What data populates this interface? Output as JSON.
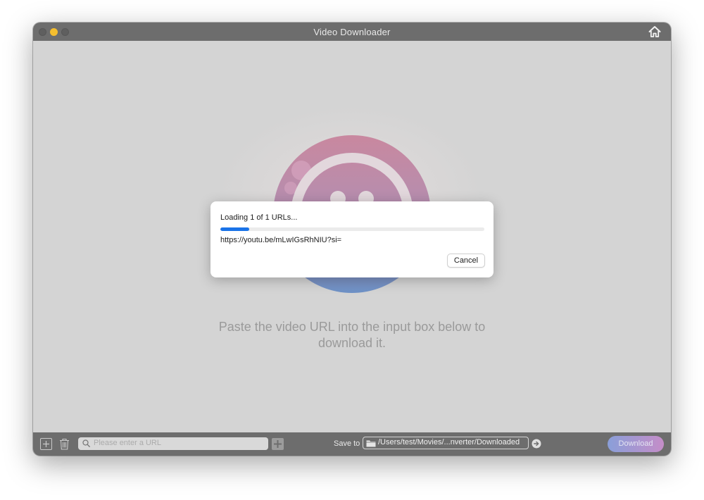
{
  "window": {
    "title": "Video Downloader"
  },
  "main": {
    "hint_line1": "Paste the video URL into the input box below to",
    "hint_line2": "download it."
  },
  "dialog": {
    "title": "Loading 1 of 1 URLs...",
    "url": "https://youtu.be/mLwIGsRhNIU?si=",
    "progress": 0.11,
    "cancel_label": "Cancel"
  },
  "bottom_bar": {
    "url_placeholder": "Please enter a URL",
    "save_to_label": "Save to",
    "save_path": "/Users/test/Movies/...nverter/Downloaded",
    "download_label": "Download"
  },
  "icons": {
    "home": "home-icon",
    "add": "add-icon",
    "trash": "trash-icon",
    "search": "search-icon",
    "folder": "folder-icon",
    "go": "arrow-right-circle-icon"
  },
  "colors": {
    "accent": "#1a73e8",
    "titlebar": "#6d6d6d",
    "minimize": "#f5be2e",
    "download_gradient_start": "#8a9fd9",
    "download_gradient_end": "#c58dc8"
  }
}
